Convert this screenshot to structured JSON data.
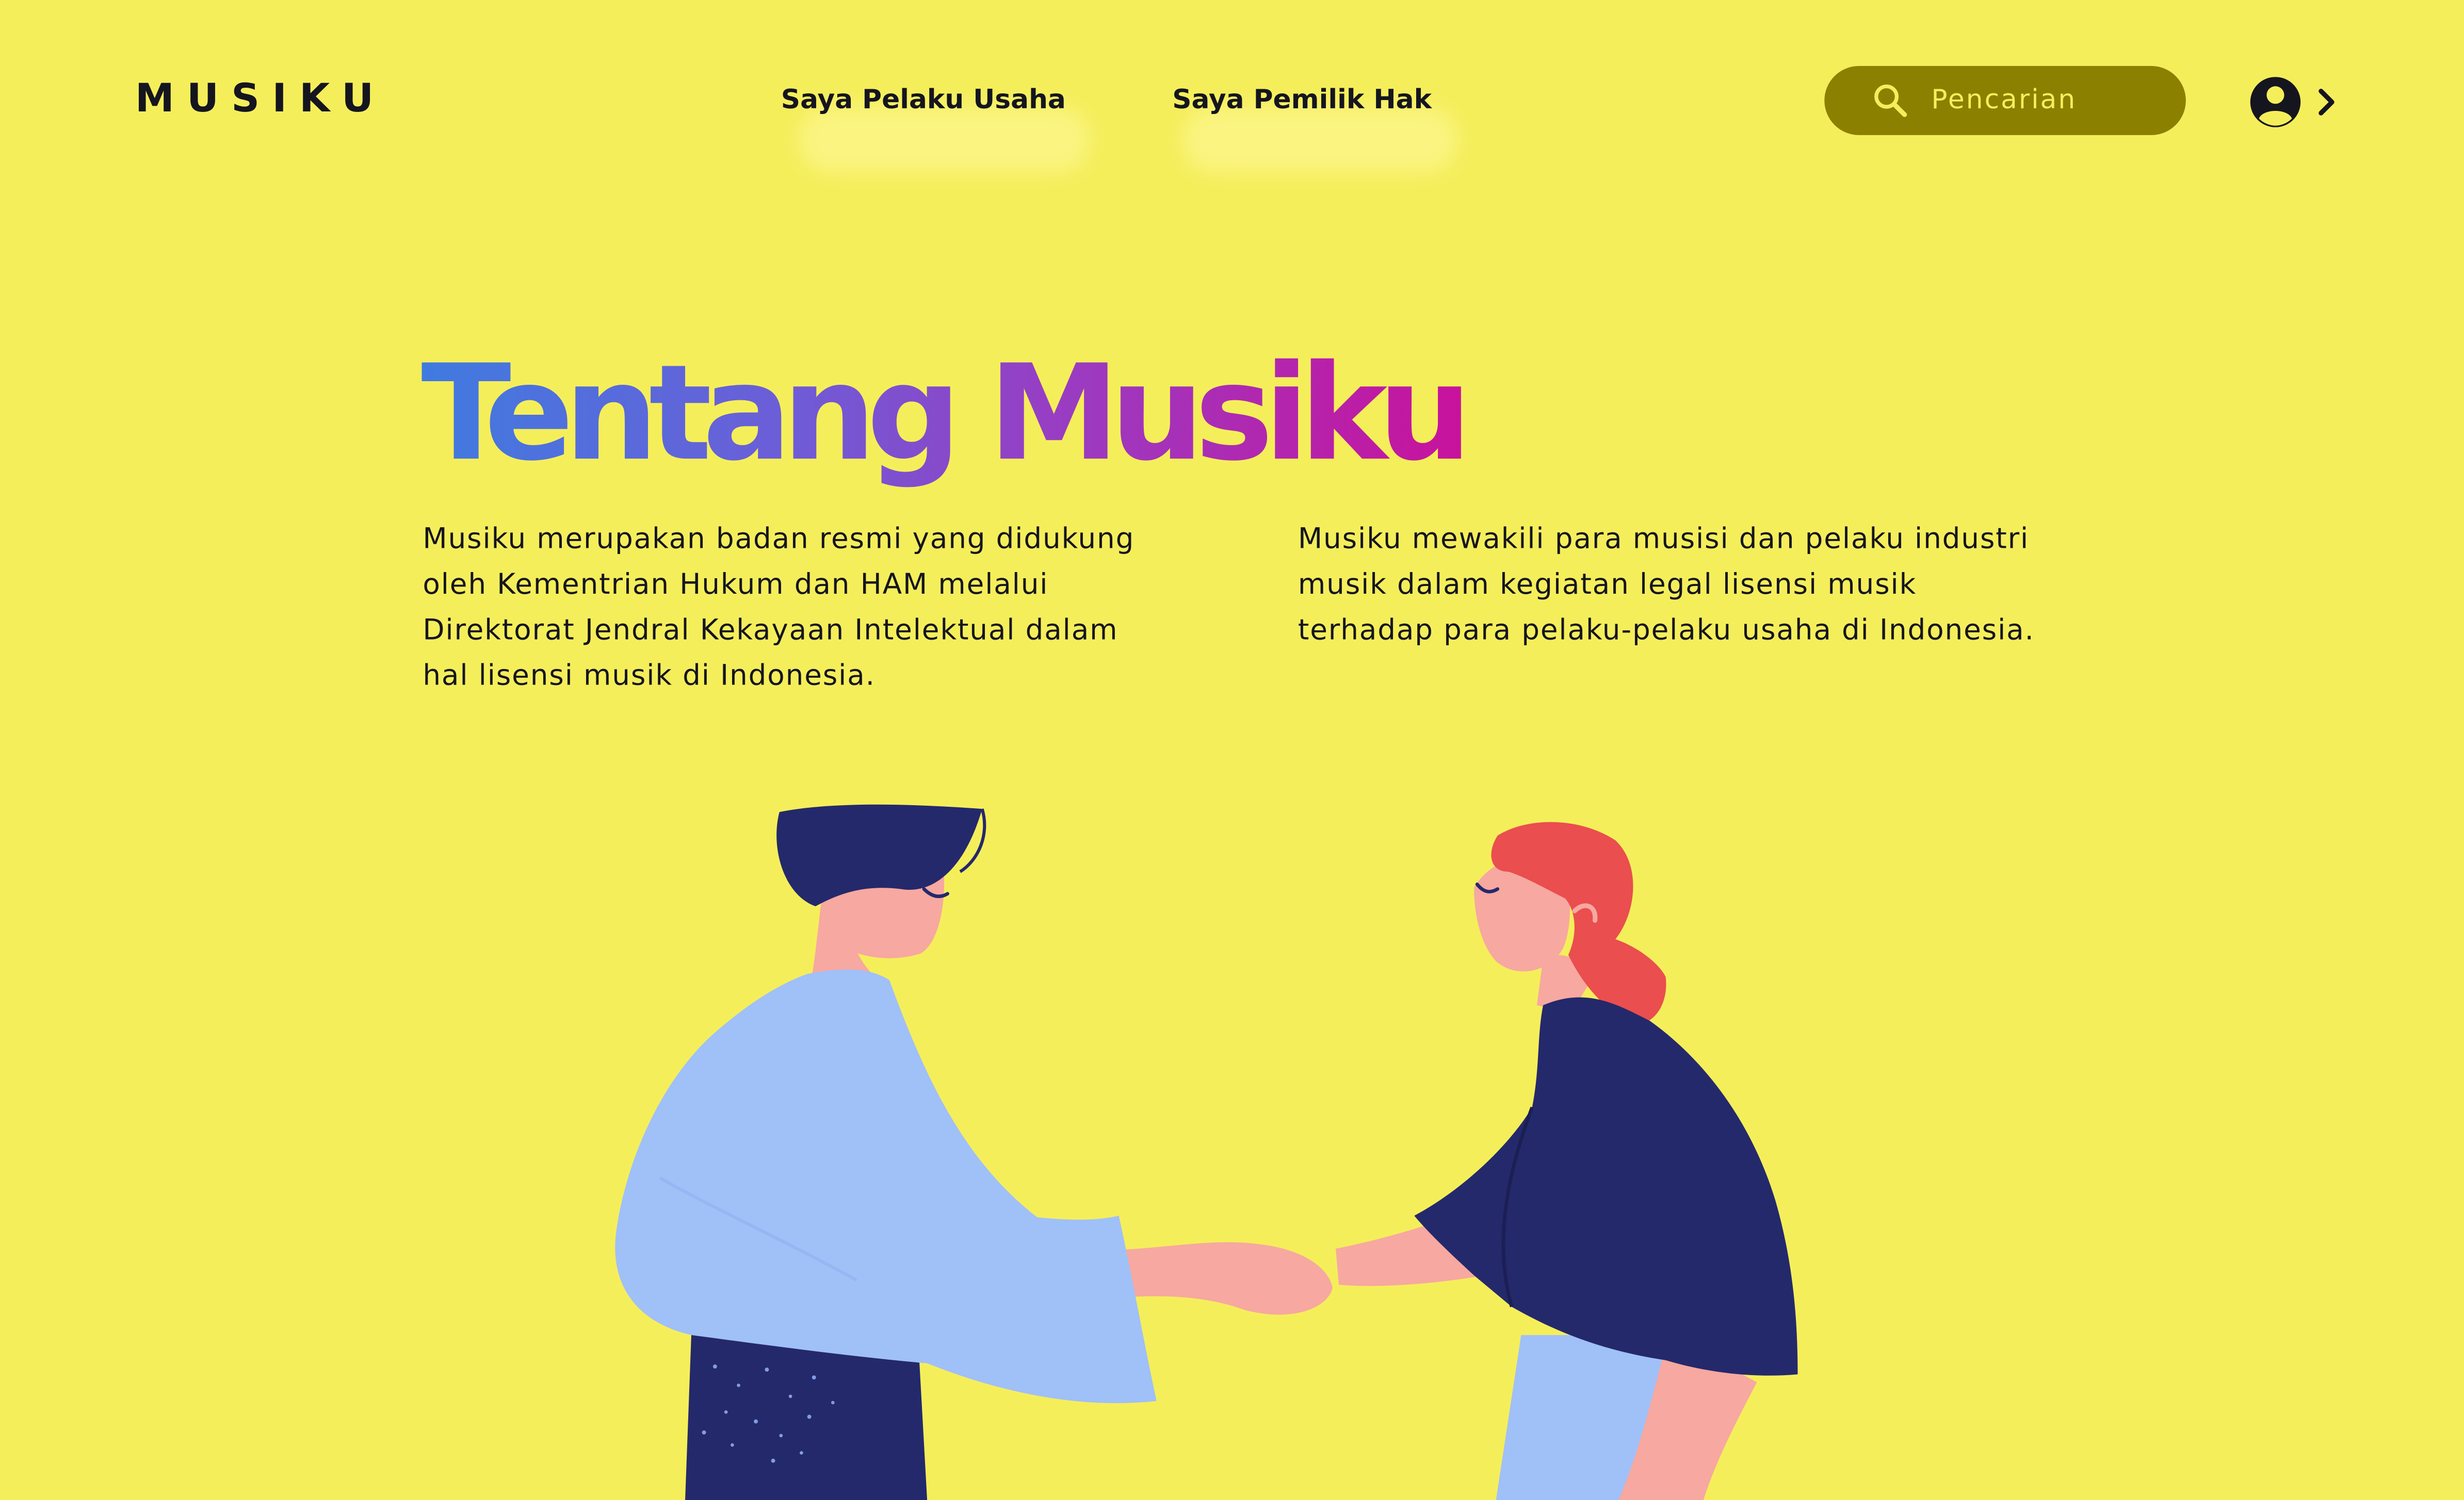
{
  "header": {
    "logo": "MUSIKU",
    "nav": [
      {
        "label": "Saya Pelaku Usaha"
      },
      {
        "label": "Saya Pemilik Hak"
      }
    ],
    "search": {
      "placeholder": "Pencarian",
      "icon": "search-icon"
    },
    "account": {
      "icon": "user-circle-icon",
      "chevron": "chevron-right-icon"
    }
  },
  "hero": {
    "title": "Tentang Musiku",
    "paragraphs": [
      "Musiku merupakan badan resmi yang didukung oleh Kementrian Hukum dan HAM melalui Direktorat Jendral Kekayaan Intelektual dalam hal lisensi musik di Indonesia.",
      "Musiku mewakili para musisi dan pelaku industri musik dalam kegiatan legal lisensi musik terhadap para pelaku-pelaku usaha di Indonesia."
    ]
  },
  "illustration": {
    "icon": "handshake-illustration"
  },
  "colors": {
    "background": "#F5EE5B",
    "search_bg": "#8C8000",
    "text": "#15151F",
    "title_gradient": [
      "#3F7BE0",
      "#9A3CC2",
      "#C8129C"
    ]
  }
}
